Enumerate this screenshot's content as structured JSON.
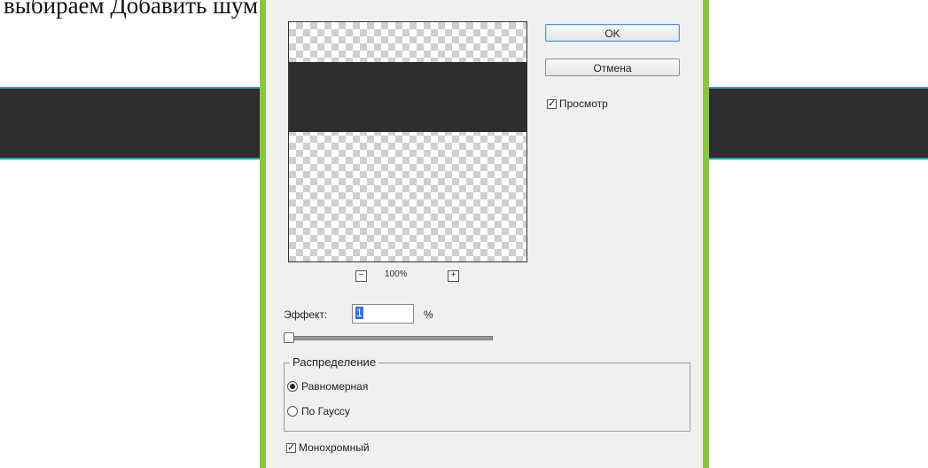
{
  "caption": {
    "text": "выбираем Добавить шум. Потом выставляем такие значения."
  },
  "dialog": {
    "ok_label": "OK",
    "cancel_label": "Отмена",
    "preview_label": "Просмотр",
    "preview_checked": true,
    "zoom": {
      "minus_icon": "zoom-out-icon",
      "plus_icon": "zoom-in-icon",
      "level": "100%"
    },
    "effect": {
      "label": "Эффект:",
      "value": "1",
      "unit": "%"
    },
    "distribution": {
      "title": "Распределение",
      "options": [
        {
          "label": "Равномерная",
          "selected": true
        },
        {
          "label": "По Гауссу",
          "selected": false
        }
      ]
    },
    "monochrome": {
      "label": "Монохромный",
      "checked": true
    }
  },
  "colors": {
    "accent_green": "#8cc63f",
    "band_dark": "#2e2e2e",
    "band_edge": "#2aa3b0"
  }
}
